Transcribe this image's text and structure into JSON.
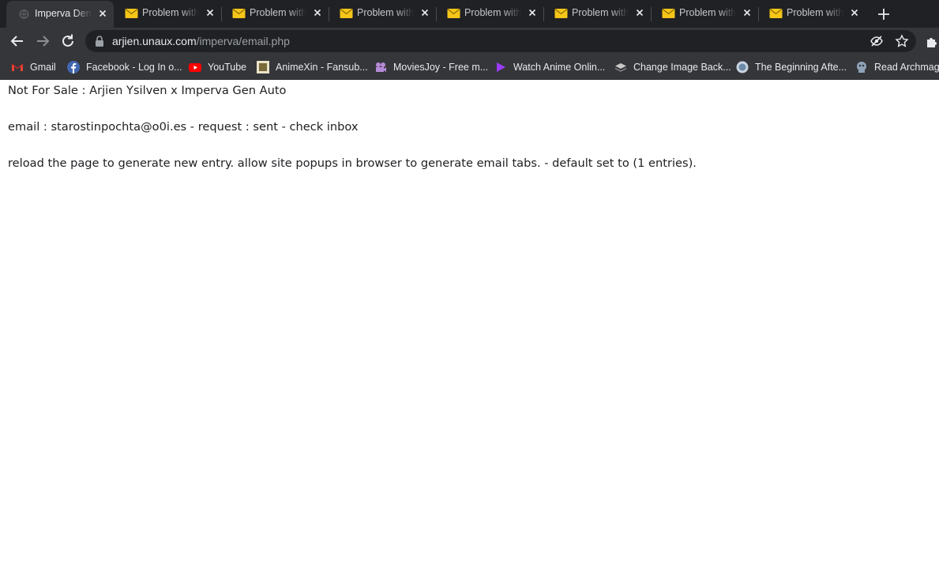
{
  "tabs": [
    {
      "title": "Imperva Demo",
      "active": true,
      "icon": "globe-icon"
    },
    {
      "title": "Problem with",
      "active": false,
      "icon": "mail-icon"
    },
    {
      "title": "Problem with",
      "active": false,
      "icon": "mail-icon"
    },
    {
      "title": "Problem with",
      "active": false,
      "icon": "mail-icon"
    },
    {
      "title": "Problem with",
      "active": false,
      "icon": "mail-icon"
    },
    {
      "title": "Problem with",
      "active": false,
      "icon": "mail-icon"
    },
    {
      "title": "Problem with",
      "active": false,
      "icon": "mail-icon"
    },
    {
      "title": "Problem with",
      "active": false,
      "icon": "mail-icon"
    }
  ],
  "address": {
    "host": "arjien.unaux.com",
    "path": "/imperva/email.php"
  },
  "bookmarks": [
    {
      "label": "Gmail",
      "icon": "gmail-icon"
    },
    {
      "label": "Facebook - Log In o...",
      "icon": "facebook-icon"
    },
    {
      "label": "YouTube",
      "icon": "youtube-icon"
    },
    {
      "label": "AnimeXin - Fansub...",
      "icon": "animexin-icon"
    },
    {
      "label": "MoviesJoy - Free m...",
      "icon": "moviesjoy-icon"
    },
    {
      "label": "Watch Anime Onlin...",
      "icon": "play-icon"
    },
    {
      "label": "Change Image Back...",
      "icon": "layers-icon"
    },
    {
      "label": "The Beginning Afte...",
      "icon": "globe-icon"
    },
    {
      "label": "Read Archmage",
      "icon": "archmage-icon"
    }
  ],
  "page": {
    "line1": "Not For Sale : Arjien Ysilven x Imperva Gen Auto",
    "line2": "email : starostinpochta@o0i.es - request : sent - check inbox",
    "line3": "reload the page to generate new entry. allow site popups in browser to generate email tabs. - default set to (1 entries)."
  },
  "colors": {
    "tabstrip": "#202124",
    "toolbar": "#35363a",
    "mail_yellow": "#f5c518"
  }
}
